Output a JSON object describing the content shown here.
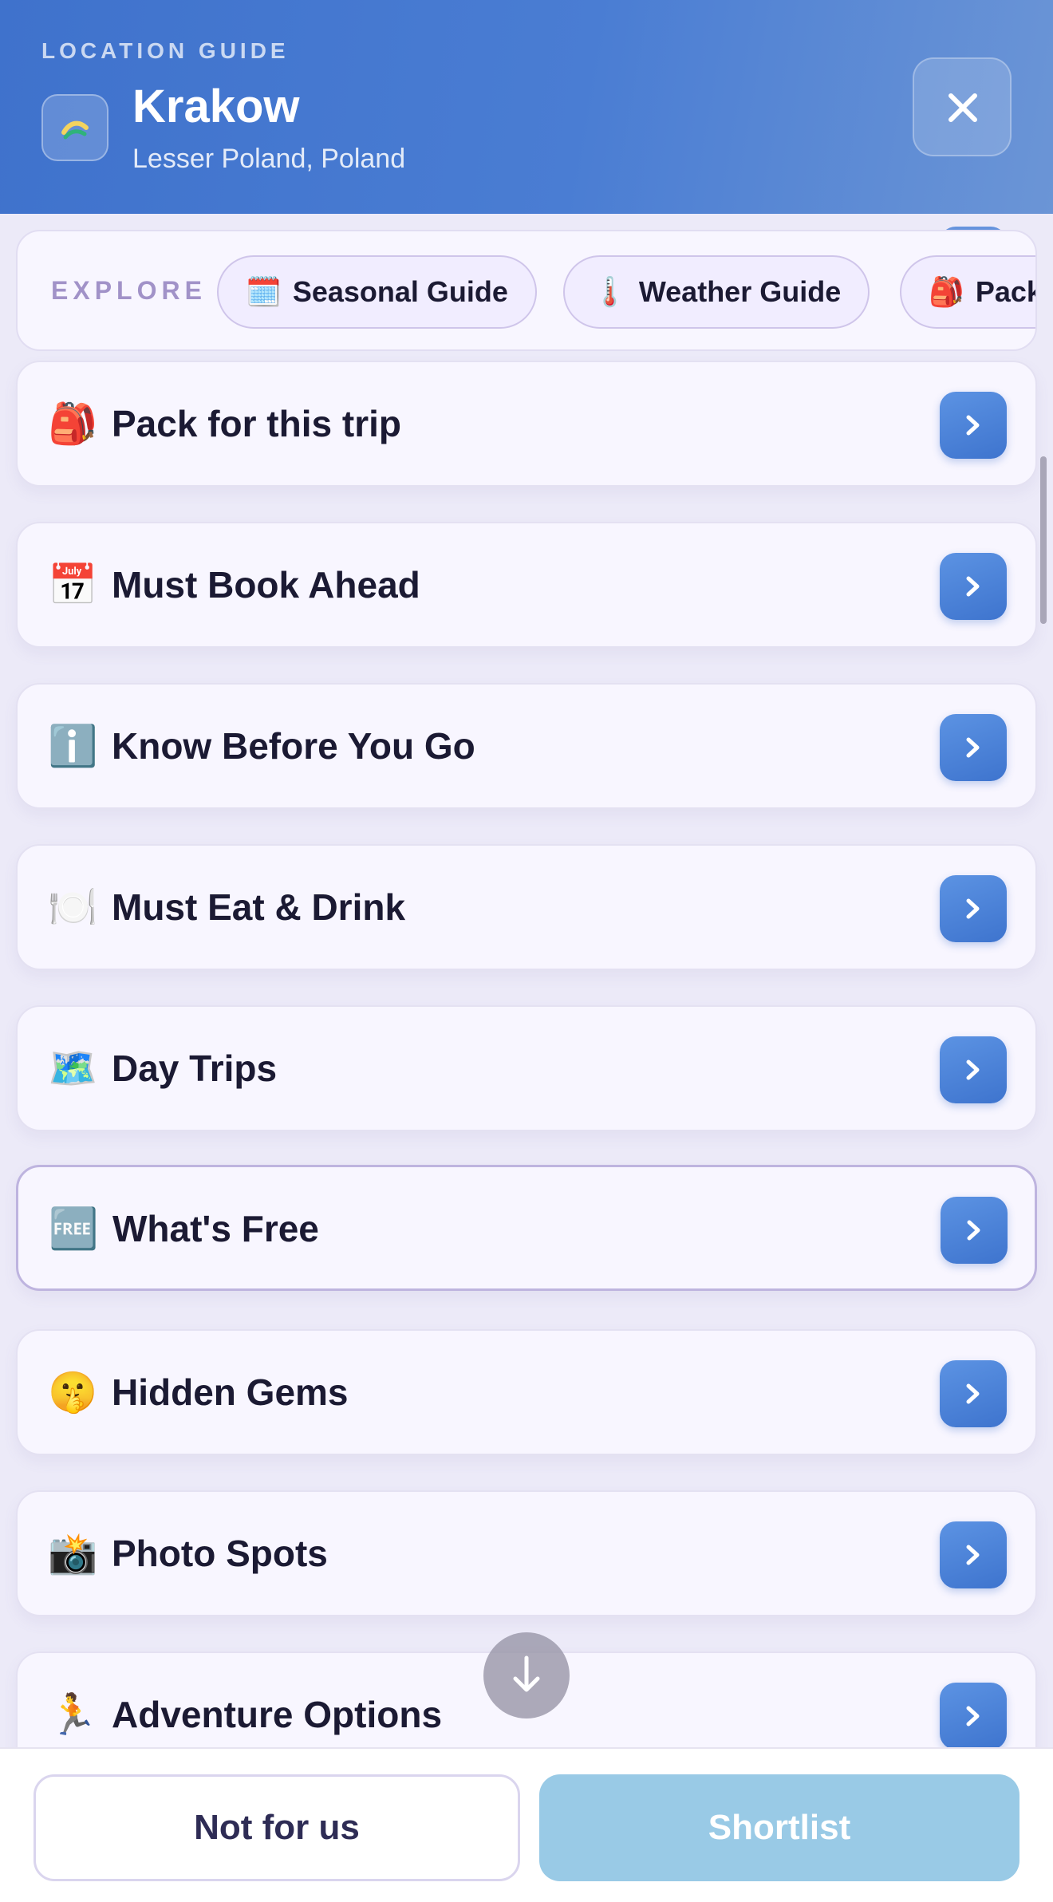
{
  "header": {
    "eyebrow": "LOCATION GUIDE",
    "city": "Krakow",
    "region": "Lesser Poland, Poland",
    "close_icon": "close-icon",
    "logo_icon": "travel-logo-icon"
  },
  "explore": {
    "label": "EXPLORE",
    "chips": [
      {
        "icon": "🗓️",
        "label": "Seasonal Guide"
      },
      {
        "icon": "🌡️",
        "label": "Weather Guide"
      },
      {
        "icon": "🎒",
        "label": "Pack"
      }
    ]
  },
  "sections": [
    {
      "icon": "🎒",
      "label": "Pack for this trip"
    },
    {
      "icon": "📅",
      "label": "Must Book Ahead"
    },
    {
      "icon": "ℹ️",
      "label": "Know Before You Go"
    },
    {
      "icon": "🍽️",
      "label": "Must Eat & Drink"
    },
    {
      "icon": "🗺️",
      "label": "Day Trips"
    },
    {
      "icon": "🆓",
      "label": "What's Free"
    },
    {
      "icon": "🤫",
      "label": "Hidden Gems"
    },
    {
      "icon": "📸",
      "label": "Photo Spots"
    },
    {
      "icon": "🏃",
      "label": "Adventure Options"
    }
  ],
  "footer": {
    "decline_label": "Not for us",
    "shortlist_label": "Shortlist"
  },
  "colors": {
    "header_start": "#3F72CC",
    "header_end": "#6B95D6",
    "accent": "#4E84D8",
    "shortlist": "#99CAE6",
    "background": "#ECEAF8"
  }
}
